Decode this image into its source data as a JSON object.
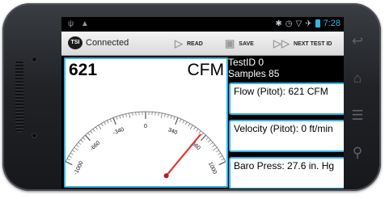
{
  "colors": {
    "accent": "#33b5e5",
    "needle": "#e03c3c"
  },
  "status_bar": {
    "left_icons": [
      "usb-icon",
      "android-debug-icon"
    ],
    "time": "7:28"
  },
  "toolbar": {
    "title": "Connected",
    "read_label": "READ",
    "save_label": "SAVE",
    "next_label": "NEXT TEST ID"
  },
  "gauge": {
    "value": "621",
    "unit": "CFM",
    "needle_value": 621,
    "min": -1000,
    "max": 1000,
    "ticks": [
      "-1000",
      "-660",
      "-340",
      "0",
      "340",
      "660",
      "1000"
    ]
  },
  "test_info": {
    "test_id_line": "TestID   0",
    "samples_line": "Samples 85"
  },
  "fields": [
    {
      "name": "flow",
      "text": "Flow (Pitot): 621 CFM"
    },
    {
      "name": "velocity",
      "text": "Velocity (Pitot): 0 ft/min"
    },
    {
      "name": "baro",
      "text": "Baro Press: 27.6 in. Hg"
    }
  ]
}
